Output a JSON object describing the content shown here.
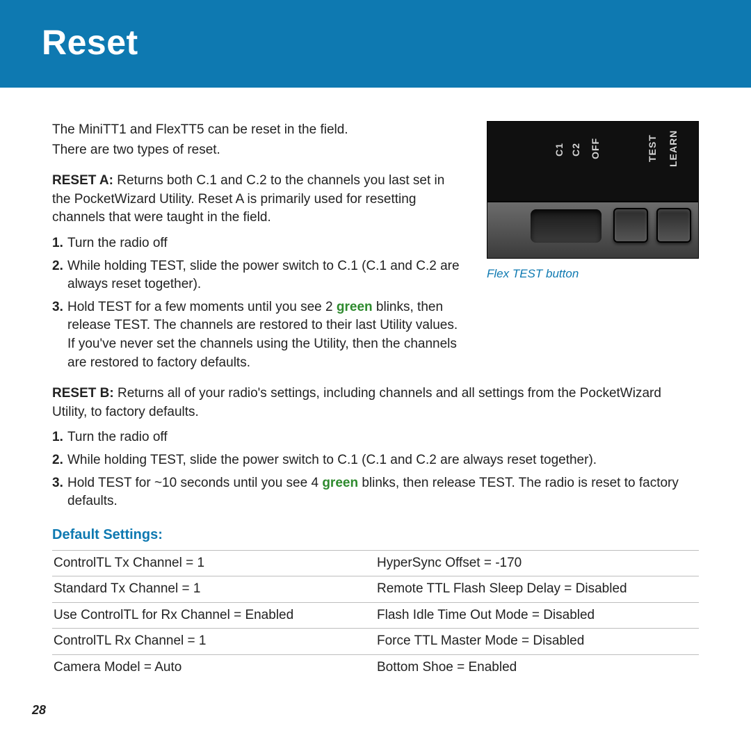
{
  "header": {
    "title": "Reset"
  },
  "image": {
    "caption": "Flex TEST button",
    "labels": {
      "c1": "C1",
      "c2": "C2",
      "off": "OFF",
      "test": "TEST",
      "learn": "LEARN"
    }
  },
  "intro": {
    "line1": "The MiniTT1 and FlexTT5 can be reset in the field.",
    "line2": "There are two types of reset."
  },
  "resetA": {
    "label": "RESET A:",
    "desc": " Returns both C.1 and C.2 to the channels you last set in the PocketWizard Utility. Reset A is primarily used for resetting channels that were taught in the field.",
    "steps": [
      "Turn the radio off",
      "While holding TEST, slide the power switch to C.1 (C.1 and C.2 are always reset together).",
      {
        "pre": "Hold TEST for a few moments until you see 2 ",
        "green": "green",
        "post": " blinks, then release TEST. The channels are restored to their last Utility values. If you've never set the channels using the Utility, then the channels are restored to factory defaults."
      }
    ]
  },
  "resetB": {
    "label": "RESET B:",
    "desc": " Returns all of your radio's settings, including channels and all settings from the PocketWizard Utility, to factory defaults.",
    "steps": [
      "Turn the radio off",
      "While holding TEST, slide the power switch to C.1 (C.1 and C.2 are always reset together).",
      {
        "pre": "Hold TEST for ~10 seconds until you see 4 ",
        "green": "green",
        "post": " blinks, then release TEST. The radio is reset to factory defaults."
      }
    ]
  },
  "defaults": {
    "title": "Default Settings:",
    "rows": [
      [
        "ControlTL Tx Channel = 1",
        "HyperSync Offset = -170"
      ],
      [
        "Standard Tx Channel = 1",
        "Remote TTL Flash Sleep Delay = Disabled"
      ],
      [
        "Use ControlTL for Rx Channel = Enabled",
        "Flash Idle Time Out Mode = Disabled"
      ],
      [
        "ControlTL Rx Channel = 1",
        "Force TTL Master Mode = Disabled"
      ],
      [
        "Camera Model = Auto",
        "Bottom Shoe = Enabled"
      ]
    ]
  },
  "pageNumber": "28"
}
